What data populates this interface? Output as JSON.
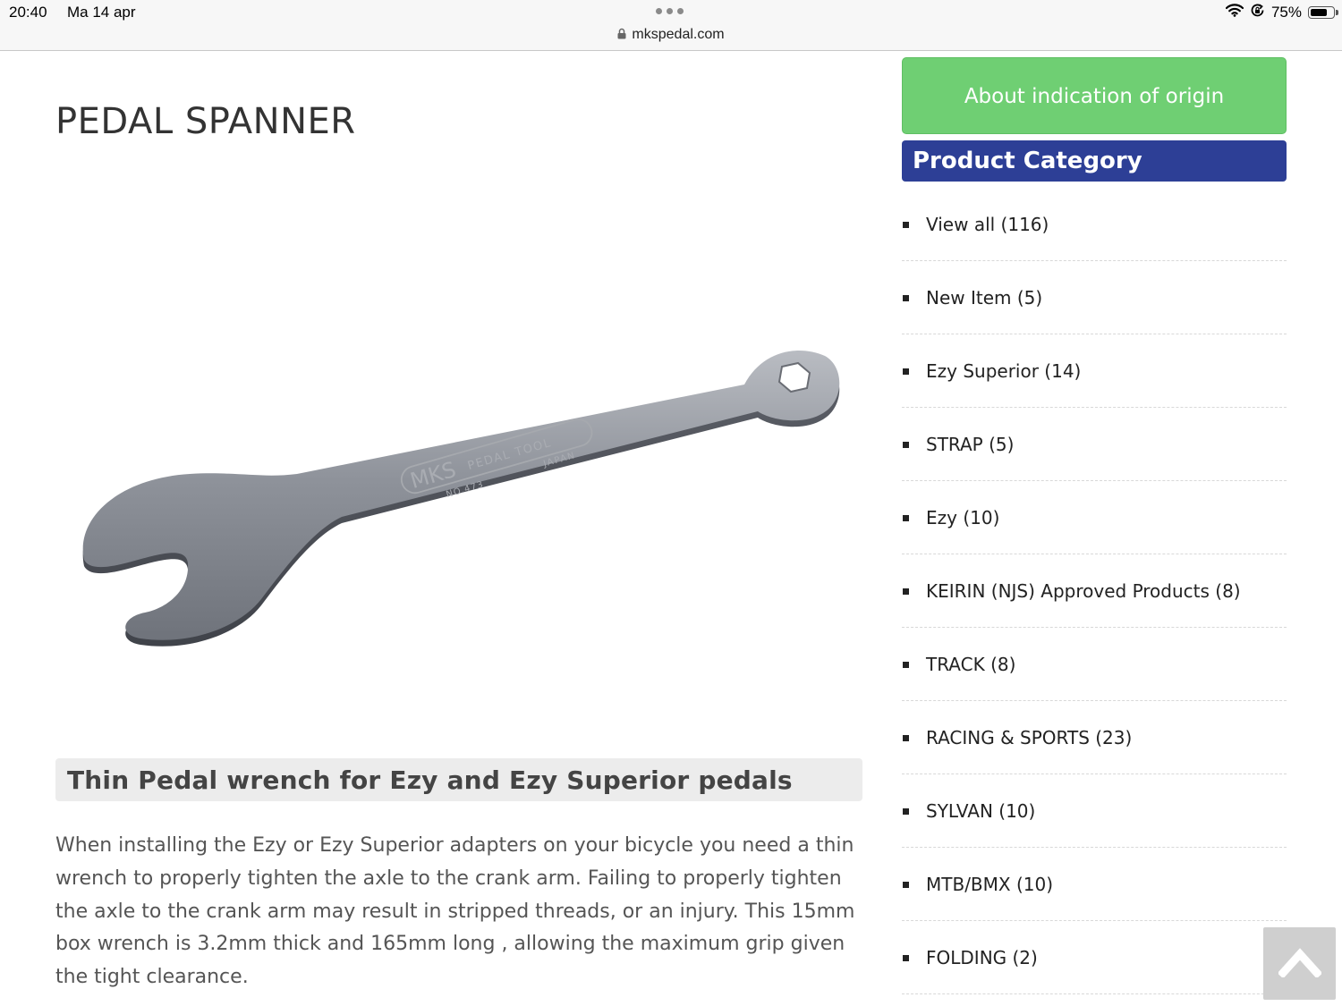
{
  "status_bar": {
    "time": "20:40",
    "date": "Ma 14 apr",
    "url": "mkspedal.com",
    "battery": "75%",
    "battery_level": 0.75
  },
  "page": {
    "title": "PEDAL SPANNER",
    "product_image_text": {
      "brand": "MKS",
      "tool_text": "PEDAL TOOL",
      "origin": "JAPAN",
      "model_no": "NO.473"
    },
    "subheading": "Thin Pedal wrench for Ezy and Ezy Superior pedals",
    "description": "When installing the Ezy or Ezy Superior adapters on your bicycle you need a thin wrench to properly tighten the axle to the crank arm. Failing to properly tighten the axle to the crank arm may result in stripped threads, or an injury. This 15mm box wrench is 3.2mm thick and 165mm long , allowing the maximum grip given the tight clearance."
  },
  "sidebar": {
    "origin_button": "About indication of origin",
    "category_header": "Product Category",
    "categories": [
      "View all (116)",
      "New Item (5)",
      "Ezy Superior (14)",
      "STRAP (5)",
      "Ezy (10)",
      "KEIRIN (NJS) Approved Products (8)",
      "TRACK (8)",
      "RACING & SPORTS (23)",
      "SYLVAN (10)",
      "MTB/BMX (10)",
      "FOLDING (2)"
    ]
  },
  "colors": {
    "origin_button": "#6fcf73",
    "category_header": "#2d3f96",
    "subhead_bg": "#ececec"
  },
  "icons": {
    "back_to_top": "chevron-up-icon",
    "lock": "lock-icon",
    "wifi": "wifi-icon",
    "orientation_lock": "orientation-lock-icon",
    "battery": "battery-icon"
  }
}
